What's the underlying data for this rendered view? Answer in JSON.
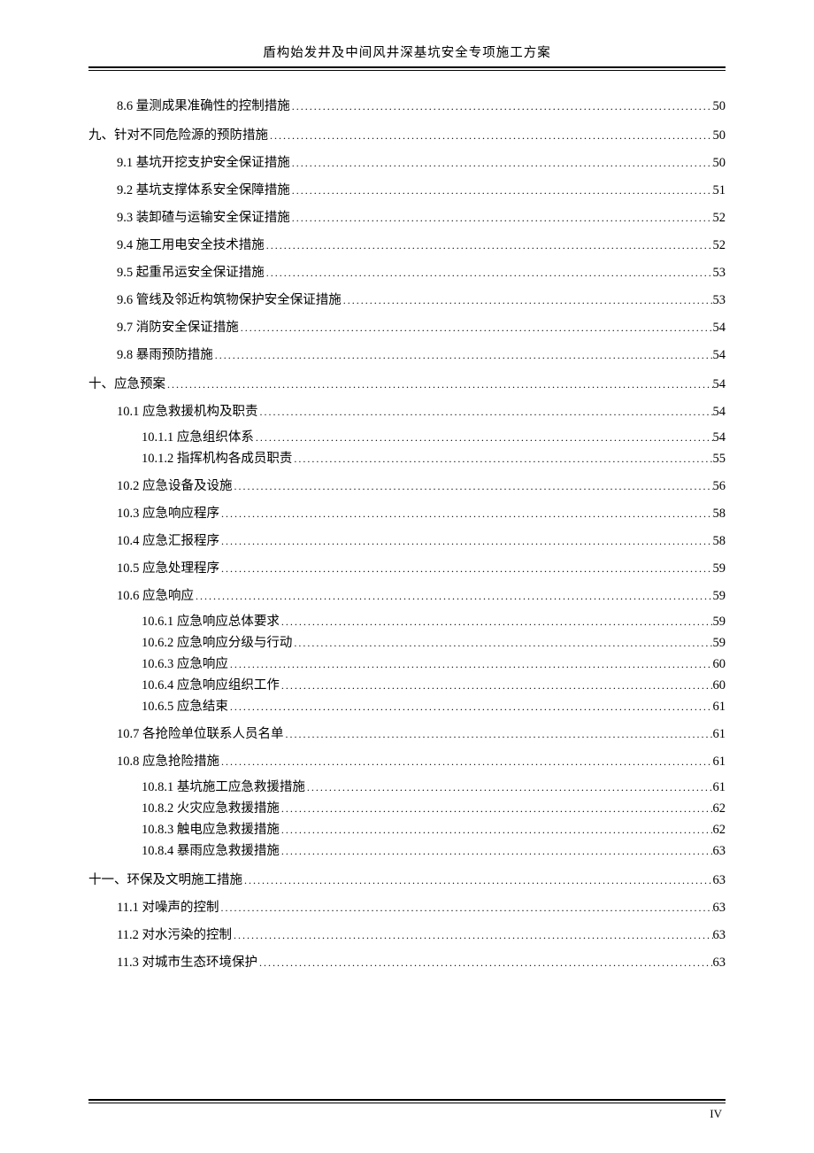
{
  "header": {
    "title": "盾构始发井及中间风井深基坑安全专项施工方案"
  },
  "footer": {
    "page": "IV"
  },
  "toc": [
    {
      "level": 2,
      "label": "8.6 量测成果准确性的控制措施",
      "page": "50"
    },
    {
      "level": 1,
      "label": "九、针对不同危险源的预防措施",
      "page": "50"
    },
    {
      "level": 2,
      "label": "9.1 基坑开挖支护安全保证措施",
      "page": "50"
    },
    {
      "level": 2,
      "label": "9.2 基坑支撑体系安全保障措施",
      "page": "51"
    },
    {
      "level": 2,
      "label": "9.3 装卸碴与运输安全保证措施",
      "page": "52"
    },
    {
      "level": 2,
      "label": "9.4 施工用电安全技术措施",
      "page": "52"
    },
    {
      "level": 2,
      "label": "9.5 起重吊运安全保证措施",
      "page": "53"
    },
    {
      "level": 2,
      "label": "9.6 管线及邻近构筑物保护安全保证措施",
      "page": "53"
    },
    {
      "level": 2,
      "label": "9.7 消防安全保证措施",
      "page": "54"
    },
    {
      "level": 2,
      "label": "9.8 暴雨预防措施",
      "page": "54"
    },
    {
      "level": 1,
      "label": "十、应急预案",
      "page": "54"
    },
    {
      "level": 2,
      "label": "10.1 应急救援机构及职责",
      "page": "54"
    },
    {
      "level": 3,
      "label": "10.1.1 应急组织体系",
      "page": "54"
    },
    {
      "level": 3,
      "label": "10.1.2 指挥机构各成员职责",
      "page": "55"
    },
    {
      "level": 2,
      "label": "10.2 应急设备及设施",
      "page": "56"
    },
    {
      "level": 2,
      "label": "10.3 应急响应程序",
      "page": "58"
    },
    {
      "level": 2,
      "label": "10.4 应急汇报程序",
      "page": "58"
    },
    {
      "level": 2,
      "label": "10.5 应急处理程序",
      "page": "59"
    },
    {
      "level": 2,
      "label": "10.6 应急响应",
      "page": "59"
    },
    {
      "level": 3,
      "label": "10.6.1  应急响应总体要求",
      "page": "59"
    },
    {
      "level": 3,
      "label": "10.6.2  应急响应分级与行动",
      "page": "59"
    },
    {
      "level": 3,
      "label": "10.6.3  应急响应",
      "page": "60"
    },
    {
      "level": 3,
      "label": "10.6.4  应急响应组织工作",
      "page": "60"
    },
    {
      "level": 3,
      "label": "10.6.5  应急结束",
      "page": "61"
    },
    {
      "level": 2,
      "label": "10.7 各抢险单位联系人员名单",
      "page": "61"
    },
    {
      "level": 2,
      "label": "10.8 应急抢险措施",
      "page": "61"
    },
    {
      "level": 3,
      "label": "10.8.1 基坑施工应急救援措施",
      "page": "61"
    },
    {
      "level": 3,
      "label": "10.8.2 火灾应急救援措施",
      "page": "62"
    },
    {
      "level": 3,
      "label": "10.8.3 触电应急救援措施",
      "page": "62"
    },
    {
      "level": 3,
      "label": "10.8.4 暴雨应急救援措施",
      "page": "63"
    },
    {
      "level": 1,
      "label": "十一、环保及文明施工措施",
      "page": "63"
    },
    {
      "level": 2,
      "label": "11.1  对噪声的控制",
      "page": "63"
    },
    {
      "level": 2,
      "label": "11.2  对水污染的控制",
      "page": "63"
    },
    {
      "level": 2,
      "label": "11.3  对城市生态环境保护",
      "page": "63"
    }
  ]
}
